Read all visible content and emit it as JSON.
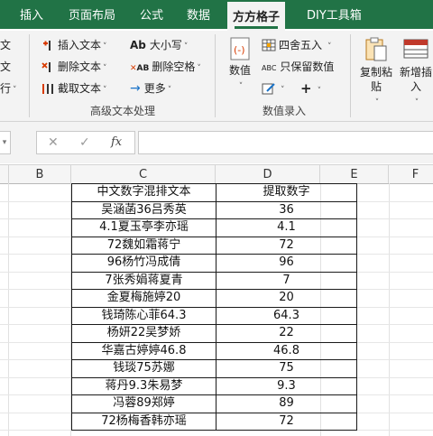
{
  "tabs": [
    {
      "label": "插入",
      "active": false
    },
    {
      "label": "页面布局",
      "active": false
    },
    {
      "label": "公式",
      "active": false
    },
    {
      "label": "数据",
      "active": false
    },
    {
      "label": "方方格子",
      "active": true
    },
    {
      "label": "DIY工具箱",
      "active": false
    }
  ],
  "ribbon": {
    "left_partial": [
      "文",
      "文",
      "行"
    ],
    "text_group": {
      "insert_text": "插入文本",
      "delete_text": "删除文本",
      "extract_text": "截取文本",
      "case": "大小写",
      "case_icon": "Ab",
      "delete_space": "删除空格",
      "delete_space_icon": "AB",
      "more": "更多",
      "label": "高级文本处理"
    },
    "number_group": {
      "value": "数值",
      "round": "四舍五入",
      "keep_numbers": "只保留数值",
      "keep_numbers_icon": "ABC",
      "plus": "+",
      "label": "数值录入"
    },
    "copy_paste": "复制粘贴",
    "new_insert": "新增插入"
  },
  "formula_bar": {
    "cancel": "✕",
    "confirm": "✓",
    "fx": "fx",
    "value": ""
  },
  "columns": [
    "B",
    "C",
    "D",
    "E",
    "F"
  ],
  "table": {
    "headers": [
      "中文数字混排文本",
      "提取数字"
    ],
    "rows": [
      [
        "吴涵菡36吕秀英",
        "36"
      ],
      [
        "4.1夏玉亭李亦瑶",
        "4.1"
      ],
      [
        "72魏如霜蒋宁",
        "72"
      ],
      [
        "96杨竹冯成倩",
        "96"
      ],
      [
        "7张秀娟蒋夏青",
        "7"
      ],
      [
        "金夏梅施婷20",
        "20"
      ],
      [
        "钱琦陈心菲64.3",
        "64.3"
      ],
      [
        "杨妍22吴梦娇",
        "22"
      ],
      [
        "华嘉古婷婷46.8",
        "46.8"
      ],
      [
        "钱琰75苏娜",
        "75"
      ],
      [
        "蒋丹9.3朱易梦",
        "9.3"
      ],
      [
        "冯蓉89郑婷",
        "89"
      ],
      [
        "72杨梅香韩亦瑶",
        "72"
      ]
    ]
  }
}
